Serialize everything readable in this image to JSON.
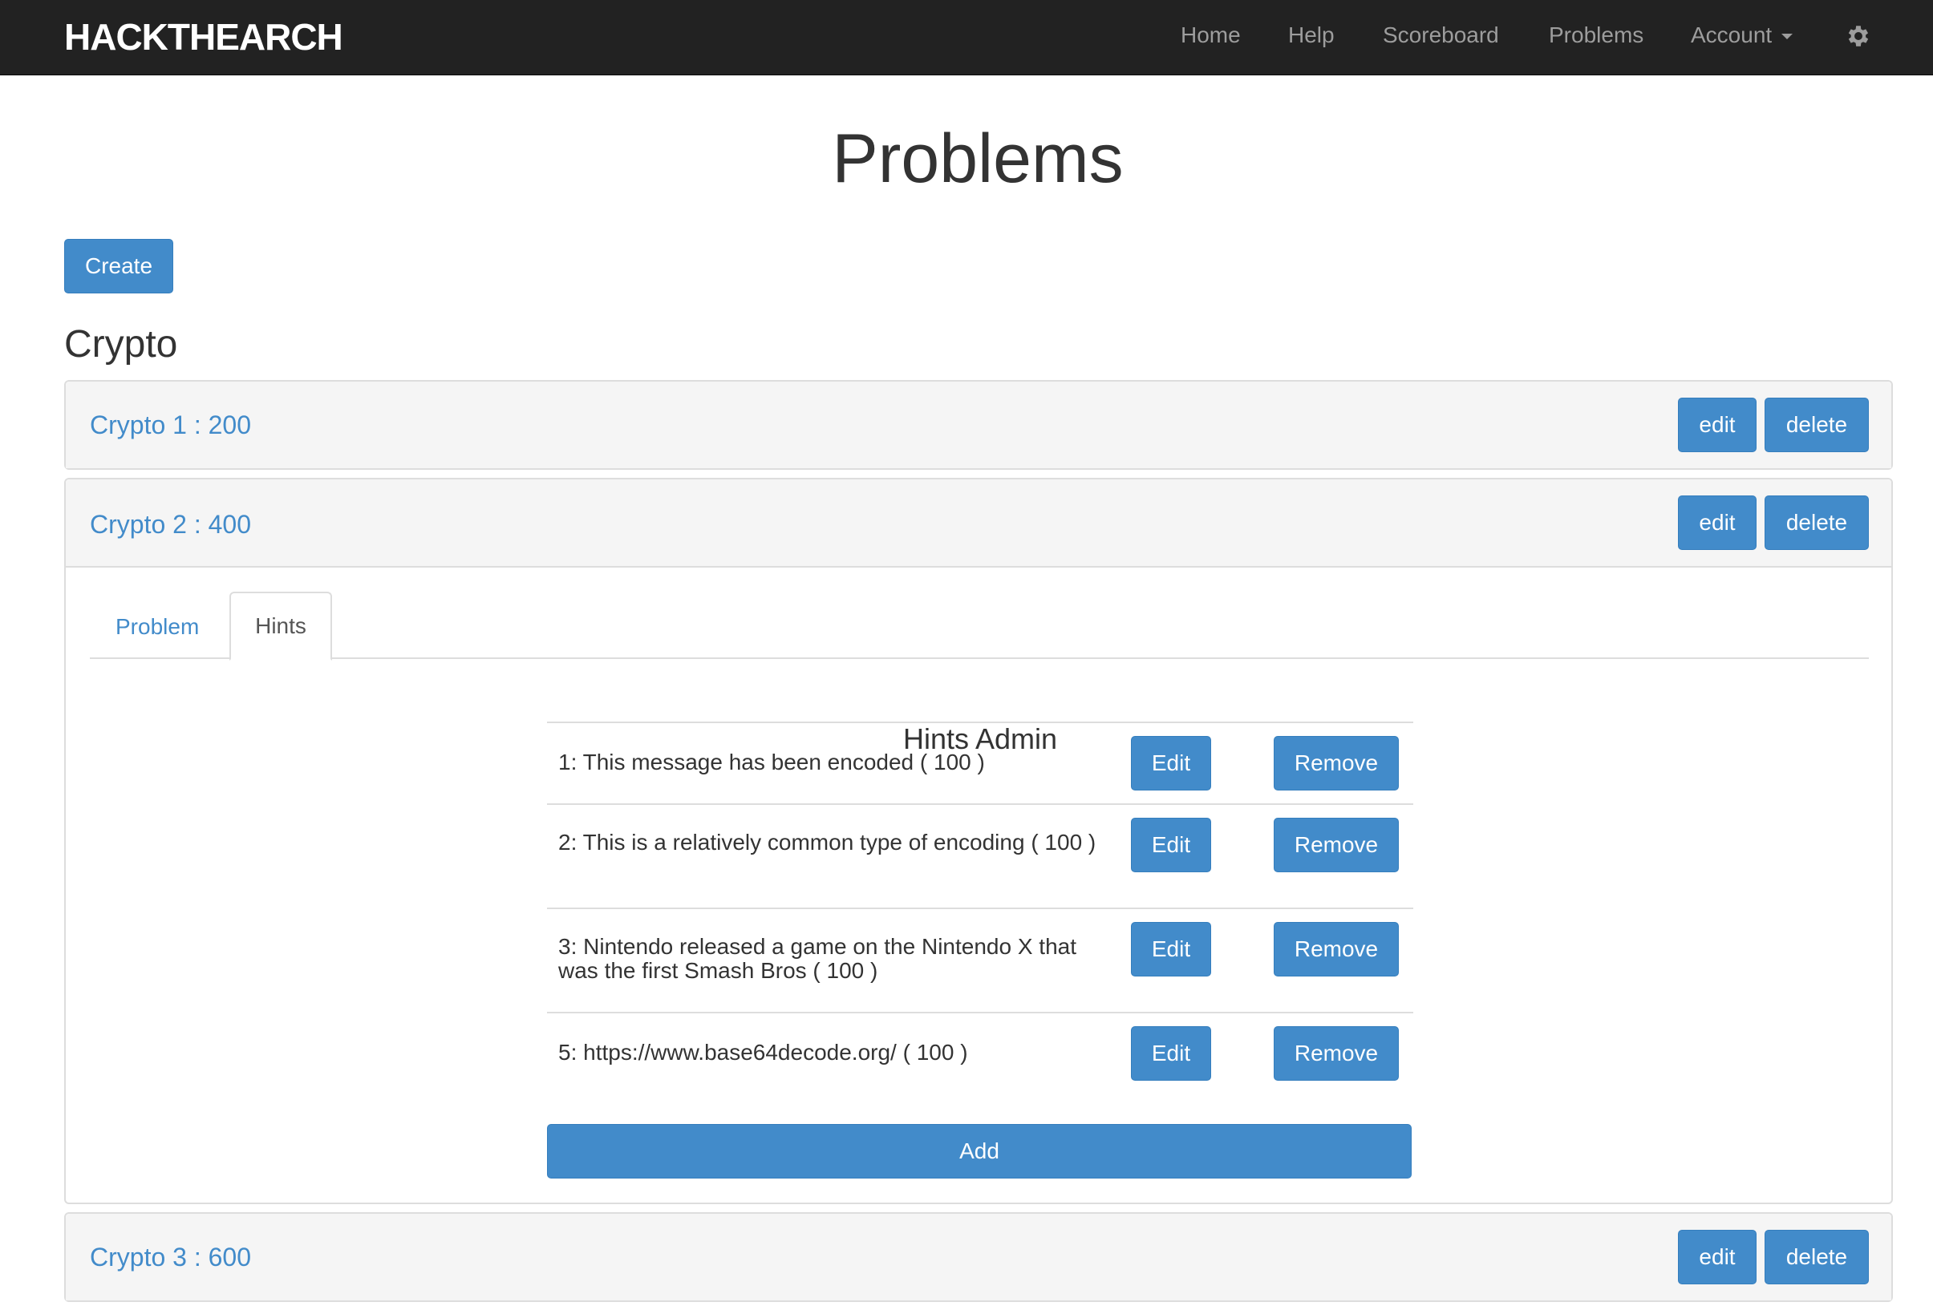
{
  "navbar": {
    "brand": "HACKTHEARCH",
    "items": [
      "Home",
      "Help",
      "Scoreboard",
      "Problems",
      "Account"
    ]
  },
  "icons": {
    "settings": "gear-icon",
    "dropdown": "caret-down-icon"
  },
  "colors": {
    "primary": "#428bca",
    "navbar_bg": "#222222",
    "nav_text": "#9d9d9d",
    "panel_head": "#f5f5f5"
  },
  "page": {
    "title": "Problems",
    "create_label": "Create"
  },
  "category": {
    "name": "Crypto"
  },
  "problems": [
    {
      "title": "Crypto 1 : 200",
      "edit": "edit",
      "delete": "delete"
    },
    {
      "title": "Crypto 2 : 400",
      "edit": "edit",
      "delete": "delete"
    },
    {
      "title": "Crypto 3 : 600",
      "edit": "edit",
      "delete": "delete"
    }
  ],
  "expanded": {
    "tabs": [
      "Problem",
      "Hints"
    ],
    "active_tab": "Hints",
    "hints_title": "Hints Admin",
    "hints": [
      {
        "text": "1: This message has been encoded ( 100 )",
        "edit": "Edit",
        "remove": "Remove"
      },
      {
        "text": "2: This is a relatively common type of encoding ( 100 )",
        "edit": "Edit",
        "remove": "Remove"
      },
      {
        "text": "3: Nintendo released a game on the Nintendo X that was the first Smash Bros ( 100 )",
        "edit": "Edit",
        "remove": "Remove"
      },
      {
        "text": "5: https://www.base64decode.org/ ( 100 )",
        "edit": "Edit",
        "remove": "Remove"
      }
    ],
    "add_label": "Add"
  }
}
